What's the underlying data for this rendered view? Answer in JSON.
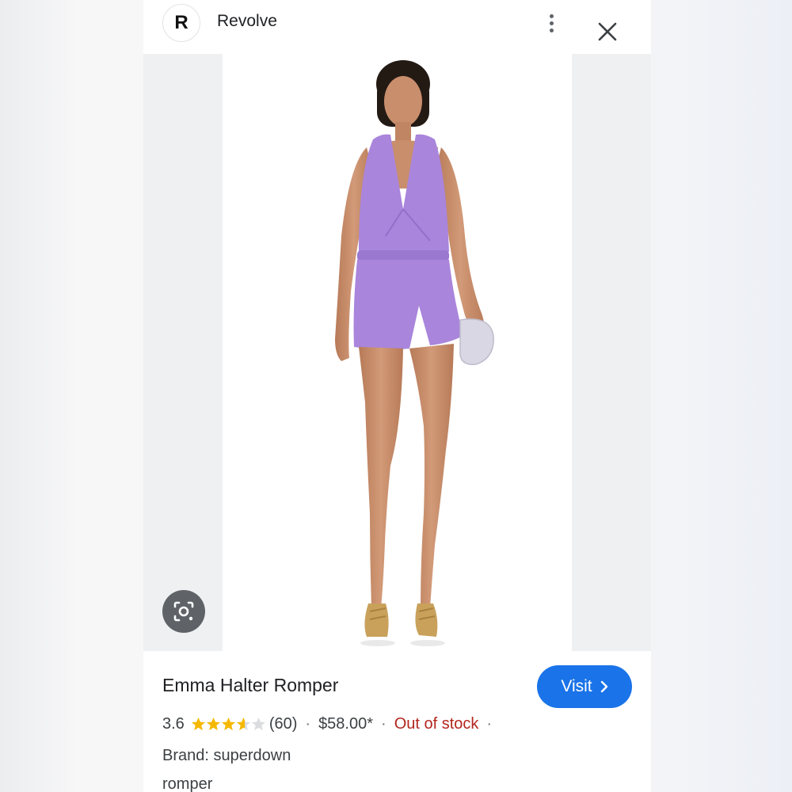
{
  "header": {
    "logo_letter": "R",
    "site_name": "Revolve"
  },
  "product": {
    "title": "Emma Halter Romper",
    "rating": "3.6",
    "rating_value": 3.6,
    "rating_max": 5,
    "review_count": "(60)",
    "price": "$58.00*",
    "stock_status": "Out of stock",
    "brand": "Brand: superdown",
    "category": "romper",
    "separator": "·"
  },
  "actions": {
    "visit_label": "Visit",
    "visit_icon": "chevron-right-icon",
    "more_icon": "more-vert-icon",
    "close_icon": "close-icon",
    "lens_icon": "google-lens-icon"
  },
  "image": {
    "description_icon": "model-in-purple-romper-photo"
  },
  "colors": {
    "accent": "#1a73e8",
    "stock_red": "#b3261e",
    "star_gold": "#f5b800",
    "star_empty": "#dadce0",
    "romper_purple": "#a985dc",
    "text": "#202124",
    "secondary_text": "#3c4043"
  }
}
